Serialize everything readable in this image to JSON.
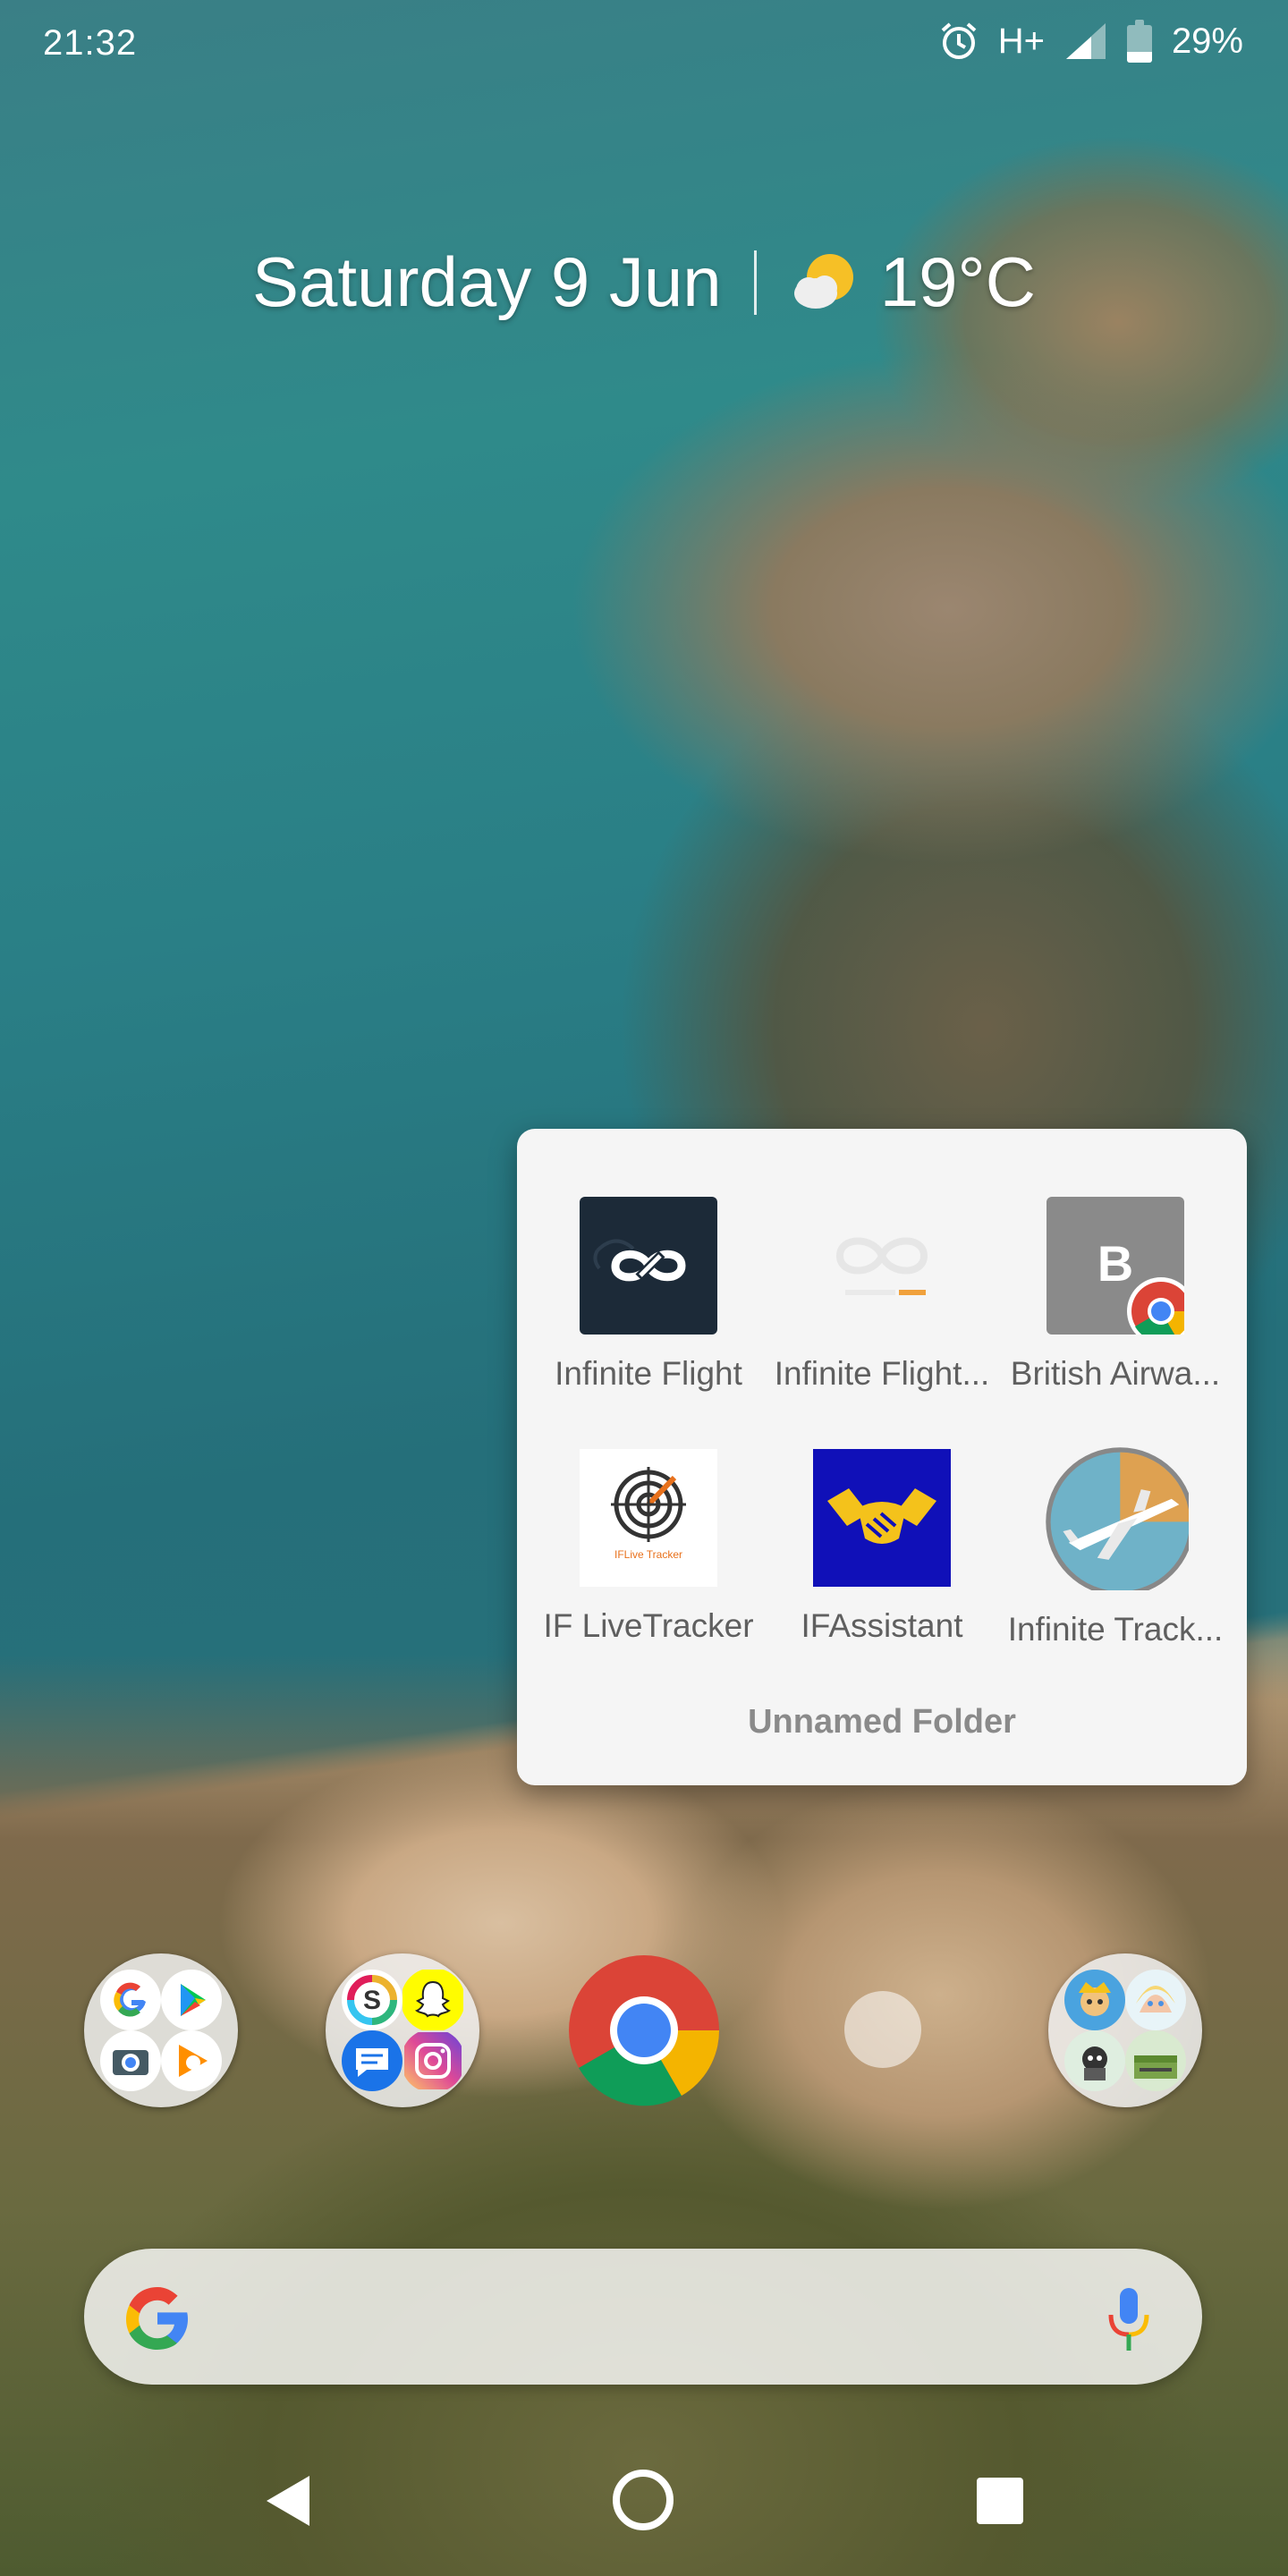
{
  "status_bar": {
    "time": "21:32",
    "network": "H+",
    "battery": "29%",
    "battery_level": 0.29,
    "icons": [
      "alarm-icon",
      "signal-icon",
      "battery-icon"
    ]
  },
  "glance": {
    "date": "Saturday 9 Jun",
    "temperature": "19°C",
    "weather_icon": "partly-cloudy-icon"
  },
  "folder": {
    "name": "Unnamed Folder",
    "apps": [
      {
        "label": "Infinite Flight",
        "icon": "infinite-flight-icon"
      },
      {
        "label": "Infinite Flight...",
        "icon": "infinite-flight-logo-icon"
      },
      {
        "label": "British Airwa...",
        "icon": "british-airways-chrome-shortcut-icon",
        "letter": "B"
      },
      {
        "label": "IF LiveTracker",
        "icon": "if-livetracker-icon",
        "icon_text": "IFLive Tracker"
      },
      {
        "label": "IFAssistant",
        "icon": "ifassistant-handshake-icon"
      },
      {
        "label": "Infinite Track...",
        "icon": "infinite-tracker-plane-icon"
      }
    ]
  },
  "dock": {
    "items": [
      "google-folder",
      "social-folder",
      "chrome-icon",
      "empty-slot",
      "games-folder"
    ],
    "social_folder_letter": "S"
  },
  "colors": {
    "folder_bg": "#f5f5f5",
    "accent_blue": "#4285f4",
    "accent_red": "#ea4335",
    "accent_yellow": "#fbbc05",
    "accent_green": "#34a853"
  }
}
